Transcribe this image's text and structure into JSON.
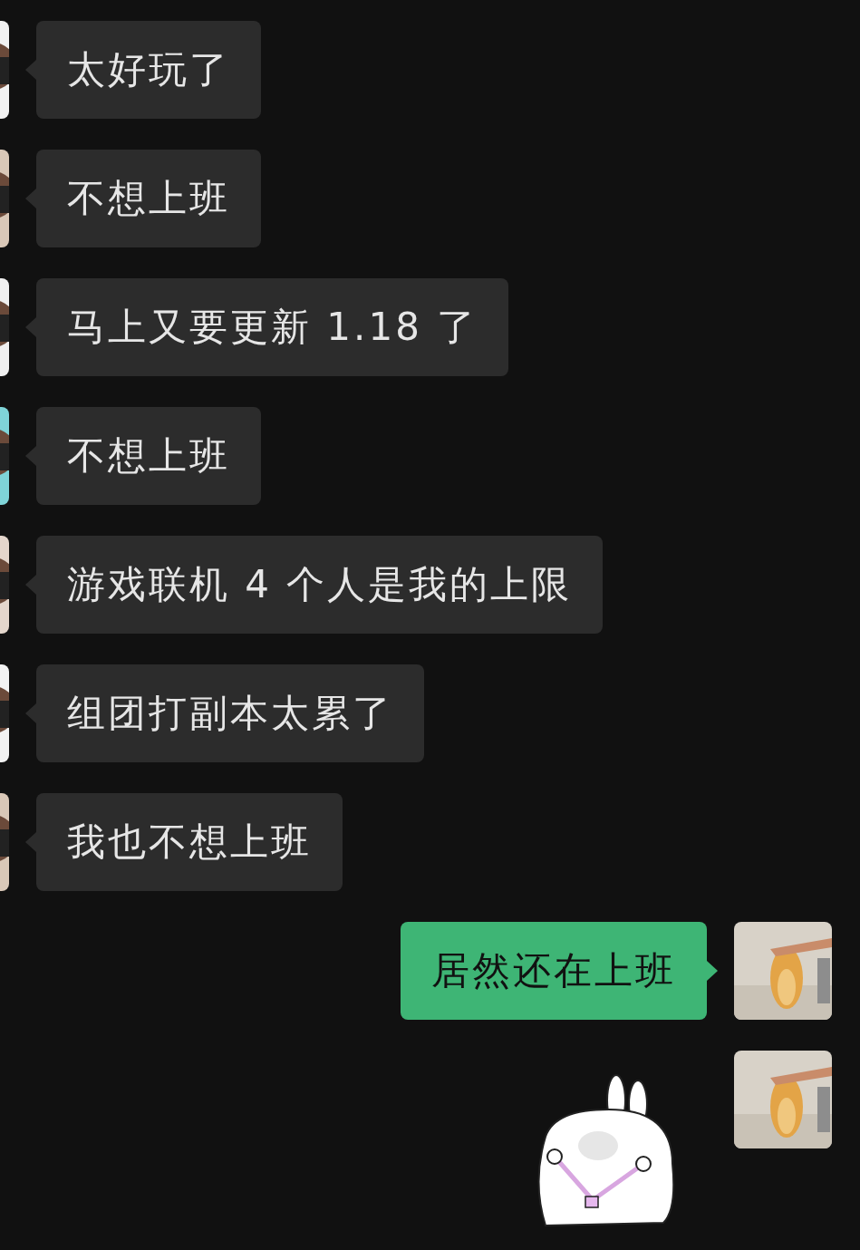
{
  "messages": [
    {
      "outgoing": false,
      "kind": "text",
      "text": "太好玩了"
    },
    {
      "outgoing": false,
      "kind": "text",
      "text": "不想上班"
    },
    {
      "outgoing": false,
      "kind": "text",
      "text": "马上又要更新 1.18 了"
    },
    {
      "outgoing": false,
      "kind": "text",
      "text": "不想上班"
    },
    {
      "outgoing": false,
      "kind": "text",
      "text": "游戏联机 4 个人是我的上限"
    },
    {
      "outgoing": false,
      "kind": "text",
      "text": "组团打副本太累了"
    },
    {
      "outgoing": false,
      "kind": "text",
      "text": "我也不想上班"
    },
    {
      "outgoing": true,
      "kind": "text",
      "text": "居然还在上班"
    },
    {
      "outgoing": true,
      "kind": "sticker"
    }
  ]
}
